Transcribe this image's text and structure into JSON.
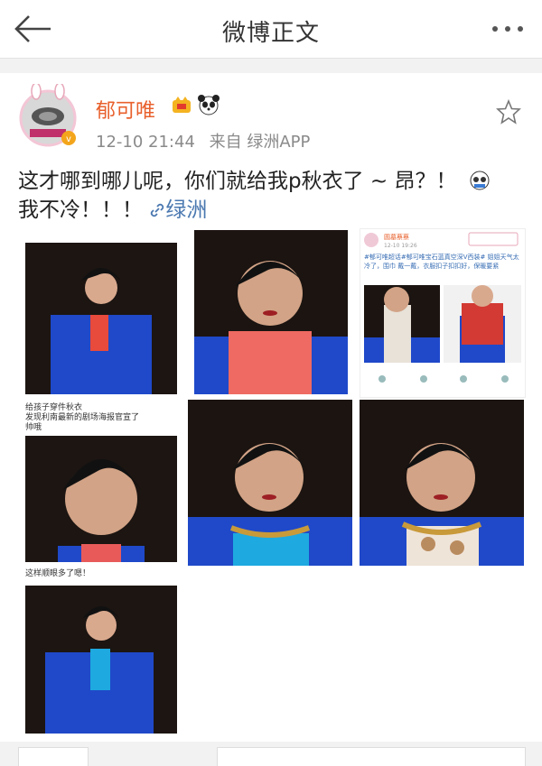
{
  "header": {
    "title": "微博正文"
  },
  "post": {
    "author": "郁可唯",
    "time": "12-10 21:44",
    "source": "来自 绿洲APP",
    "text": "这才哪到哪儿呢，你们就给我p秋衣了 ~ 昂？！",
    "text2": "我不冷！！！",
    "link": "绿洲"
  },
  "images": {
    "cap1": "给孩子穿件秋衣",
    "cap1b": "发现利南最新的剧场海报官宣了",
    "cap1c": "帅哦",
    "cap2": "这样顺眼多了嗯！",
    "mini_name": "圆墓蔡蔡",
    "mini_time": "12-10 19:26",
    "mini_text": "#郁可唯超话#郁可唯宝石蓝真空深V西装# 姐姐天气太冷了，围巾 戴一戴，衣服扣子扣扣好，保暖要紧"
  },
  "colors": {
    "accent": "#e8602c",
    "link": "#4a78b0",
    "suit": "#1f49c9"
  }
}
